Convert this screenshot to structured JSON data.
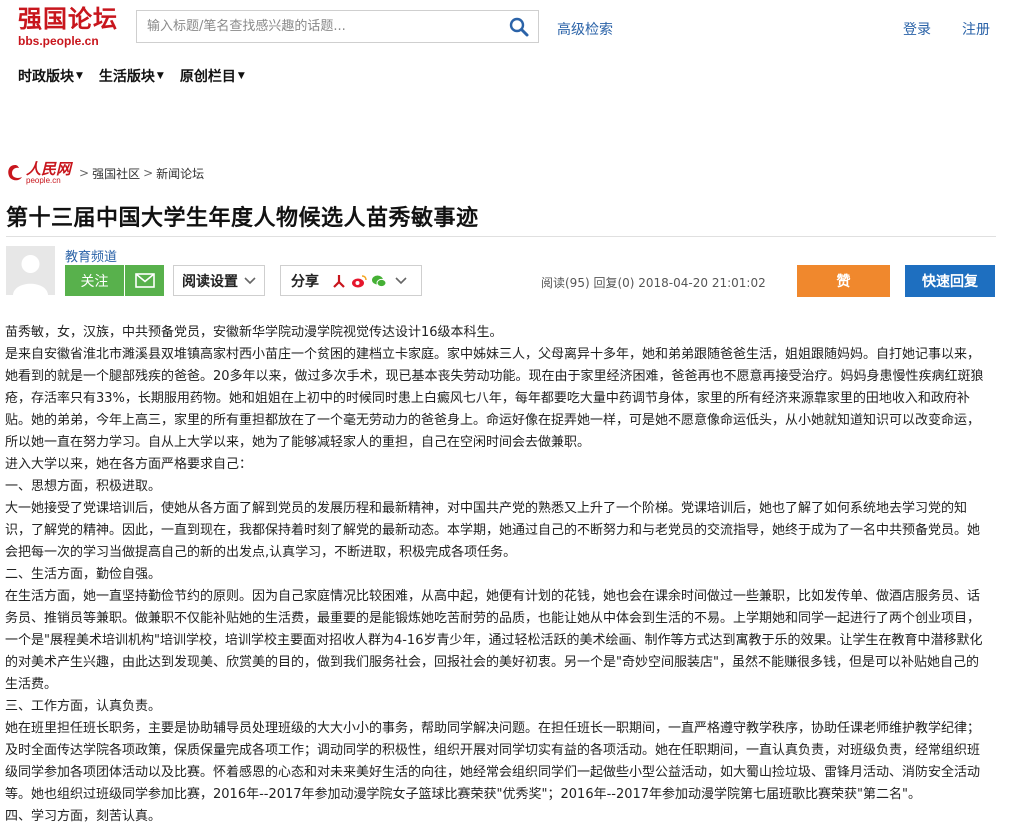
{
  "header": {
    "logo_title": "强国论坛",
    "logo_sub": "bbs.people.cn",
    "search_placeholder": "输入标题/笔名查找感兴趣的话题...",
    "advanced_search": "高级检索",
    "login": "登录",
    "register": "注册"
  },
  "nav": {
    "items": [
      {
        "label": "时政版块"
      },
      {
        "label": "生活版块"
      },
      {
        "label": "原创栏目"
      }
    ]
  },
  "breadcrumb": {
    "logo_main": "人民网",
    "logo_sub": "people.cn",
    "items": [
      "强国社区",
      "新闻论坛"
    ]
  },
  "post": {
    "title": "第十三届中国大学生年度人物候选人苗秀敏事迹",
    "channel": "教育频道",
    "follow_label": "关注",
    "read_settings_label": "阅读设置",
    "share_label": "分享",
    "stats": "阅读(95) 回复(0)  2018-04-20 21:01:02",
    "like_label": "赞",
    "quick_reply_label": "快速回复"
  },
  "article": {
    "paragraphs": [
      "苗秀敏，女，汉族，中共预备党员，安徽新华学院动漫学院视觉传达设计16级本科生。",
      "是来自安徽省淮北市濉溪县双堆镇高家村西小苗庄一个贫困的建档立卡家庭。家中姊妹三人，父母离异十多年，她和弟弟跟随爸爸生活，姐姐跟随妈妈。自打她记事以来，她看到的就是一个腿部残疾的爸爸。20多年以来，做过多次手术，现已基本丧失劳动功能。现在由于家里经济困难，爸爸再也不愿意再接受治疗。妈妈身患慢性疾病红斑狼疮，存活率只有33%，长期服用药物。她和姐姐在上初中的时候同时患上白癜风七八年，每年都要吃大量中药调节身体，家里的所有经济来源靠家里的田地收入和政府补贴。她的弟弟，今年上高三，家里的所有重担都放在了一个毫无劳动力的爸爸身上。命运好像在捉弄她一样，可是她不愿意像命运低头，从小她就知道知识可以改变命运，所以她一直在努力学习。自从上大学以来，她为了能够减轻家人的重担，自己在空闲时间会去做兼职。",
      "进入大学以来，她在各方面严格要求自己：",
      "一、思想方面，积极进取。",
      "大一她接受了党课培训后，使她从各方面了解到党员的发展历程和最新精神，对中国共产党的熟悉又上升了一个阶梯。党课培训后，她也了解了如何系统地去学习党的知识，了解党的精神。因此，一直到现在，我都保持着时刻了解党的最新动态。本学期，她通过自己的不断努力和与老党员的交流指导，她终于成为了一名中共预备党员。她会把每一次的学习当做提高自己的新的出发点,认真学习，不断进取，积极完成各项任务。",
      "二、生活方面，勤俭自强。",
      "在生活方面，她一直坚持勤俭节约的原则。因为自己家庭情况比较困难，从高中起，她便有计划的花钱，她也会在课余时间做过一些兼职，比如发传单、做酒店服务员、话务员、推销员等兼职。做兼职不仅能补贴她的生活费，最重要的是能锻炼她吃苦耐劳的品质，也能让她从中体会到生活的不易。上学期她和同学一起进行了两个创业项目，一个是\"展程美术培训机构\"培训学校，培训学校主要面对招收人群为4-16岁青少年，通过轻松活跃的美术绘画、制作等方式达到寓教于乐的效果。让学生在教育中潜移默化的对美术产生兴趣，由此达到发现美、欣赏美的目的，做到我们服务社会，回报社会的美好初衷。另一个是\"奇妙空间服装店\"，虽然不能赚很多钱，但是可以补贴她自己的生活费。",
      "三、工作方面，认真负责。",
      "她在班里担任班长职务，主要是协助辅导员处理班级的大大小小的事务，帮助同学解决问题。在担任班长一职期间，一直严格遵守教学秩序，协助任课老师维护教学纪律；及时全面传达学院各项政策，保质保量完成各项工作；调动同学的积极性，组织开展对同学切实有益的各项活动。她在任职期间，一直认真负责，对班级负责，经常组织班级同学参加各项团体活动以及比赛。怀着感恩的心态和对未来美好生活的向往，她经常会组织同学们一起做些小型公益活动，如大蜀山捡垃圾、雷锋月活动、消防安全活动等。她也组织过班级同学参加比赛，2016年--2017年参加动漫学院女子篮球比赛荣获\"优秀奖\"；2016年--2017年参加动漫学院第七届班歌比赛荣获\"第二名\"。",
      "四、学习方面，刻苦认真。"
    ]
  },
  "colors": {
    "brand_red": "#c8161d",
    "link_blue": "#2b63a8",
    "follow_green": "#58b14c",
    "like_orange": "#f0882d",
    "reply_blue": "#1e6fc0"
  },
  "icons": [
    "search-icon",
    "mail-icon",
    "chevron-down-icon",
    "weibo-icon",
    "wechat-icon",
    "people-icon",
    "avatar-icon"
  ]
}
